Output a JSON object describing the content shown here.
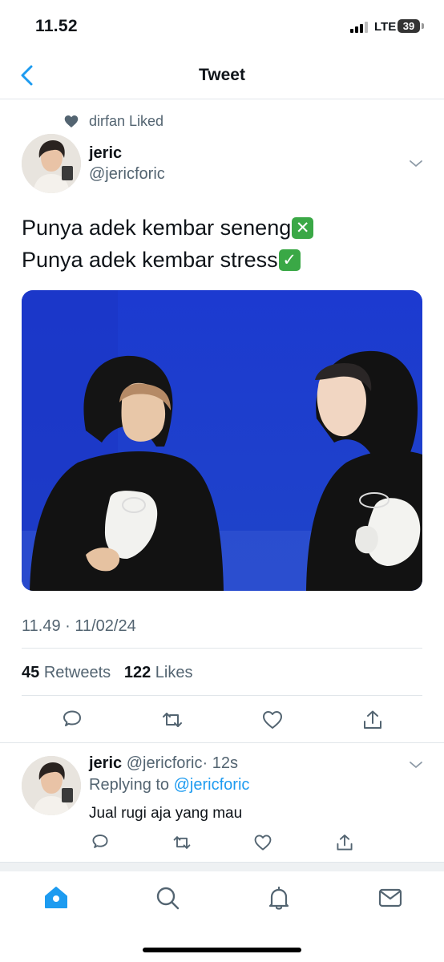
{
  "status_bar": {
    "time": "11.52",
    "network": "LTE",
    "battery": "39"
  },
  "header": {
    "title": "Tweet"
  },
  "social_context": {
    "text": "dirfan Liked"
  },
  "tweet": {
    "author_name": "jeric",
    "author_handle": "@jericforic",
    "text_line_1": "Punya adek kembar seneng",
    "text_line_1_emoji": "✕",
    "text_line_2": "Punya adek kembar stress",
    "text_line_2_emoji": "✓",
    "timestamp": "11.49 · 11/02/24",
    "retweet_count": "45",
    "retweet_label": "Retweets",
    "like_count": "122",
    "like_label": "Likes"
  },
  "reply": {
    "author_name": "jeric",
    "author_handle": "@jericforic",
    "time": "· 12s",
    "replying_label": "Replying to",
    "replying_handle": "@jericforic",
    "text": "Jual rugi aja yang mau"
  },
  "colors": {
    "accent": "#1d9bf0",
    "secondary_text": "#536471",
    "media_background": "#1f3fc8"
  },
  "icons": {
    "header": [
      "back-chevron-icon"
    ],
    "actions": [
      "reply-icon",
      "retweet-icon",
      "like-icon",
      "share-icon"
    ],
    "tabs": [
      "home-icon",
      "search-icon",
      "notifications-icon",
      "messages-icon"
    ]
  }
}
